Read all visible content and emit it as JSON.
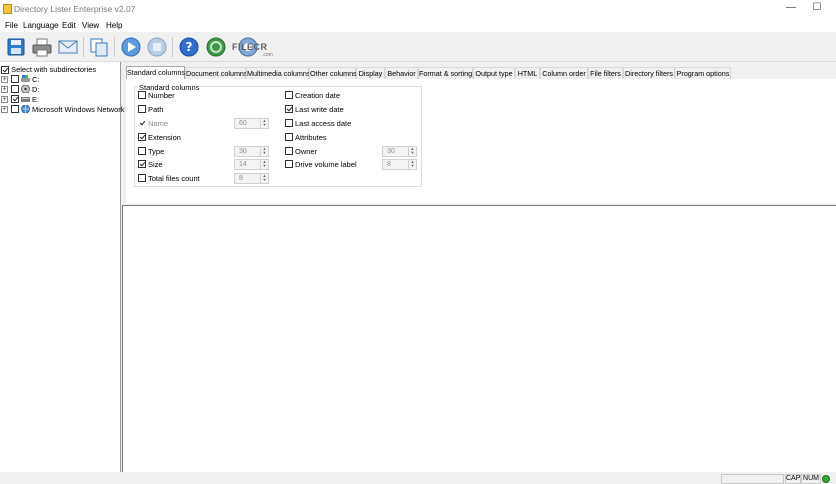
{
  "window": {
    "title": "Directory Lister Enterprise v2.07",
    "minimize": "—",
    "maximize": "☐"
  },
  "menu": [
    "File",
    "Language",
    "Edit",
    "View",
    "Help"
  ],
  "toolbar": {
    "buttons": [
      "save-icon",
      "print-icon",
      "email-icon",
      "copy-icon",
      "play-icon",
      "stop-icon",
      "help-icon",
      "update-icon",
      "settings-icon"
    ],
    "watermark": "FILECR",
    "watermark_sub": ".com"
  },
  "tree": {
    "select_subdirs": "Select with subdirectories",
    "items": [
      {
        "label": "C:",
        "checked": false
      },
      {
        "label": "D:",
        "checked": false
      },
      {
        "label": "E:",
        "checked": true
      },
      {
        "label": "Microsoft Windows Network",
        "checked": false
      }
    ]
  },
  "tabs": [
    "Standard columns",
    "Document columns",
    "Multimedia columns",
    "Other columns",
    "Display",
    "Behavior",
    "Format & sorting",
    "Output type",
    "HTML",
    "Column order",
    "File filters",
    "Directory filters",
    "Program options"
  ],
  "group": {
    "label": "Standard columns",
    "left": [
      {
        "label": "Number",
        "checked": false
      },
      {
        "label": "Path",
        "checked": false
      },
      {
        "label": "Name",
        "checked": true,
        "disabled": true,
        "width": "60"
      },
      {
        "label": "Extension",
        "checked": true
      },
      {
        "label": "Type",
        "checked": false,
        "width": "30"
      },
      {
        "label": "Size",
        "checked": true,
        "width": "14"
      },
      {
        "label": "Total files count",
        "checked": false,
        "width": "8"
      }
    ],
    "right": [
      {
        "label": "Creation date",
        "checked": false
      },
      {
        "label": "Last write date",
        "checked": true
      },
      {
        "label": "Last access date",
        "checked": false
      },
      {
        "label": "Attributes",
        "checked": false
      },
      {
        "label": "Owner",
        "checked": false,
        "width": "30"
      },
      {
        "label": "Drive volume label",
        "checked": false,
        "width": "8"
      }
    ]
  },
  "status": {
    "cap": "CAP",
    "num": "NUM"
  }
}
